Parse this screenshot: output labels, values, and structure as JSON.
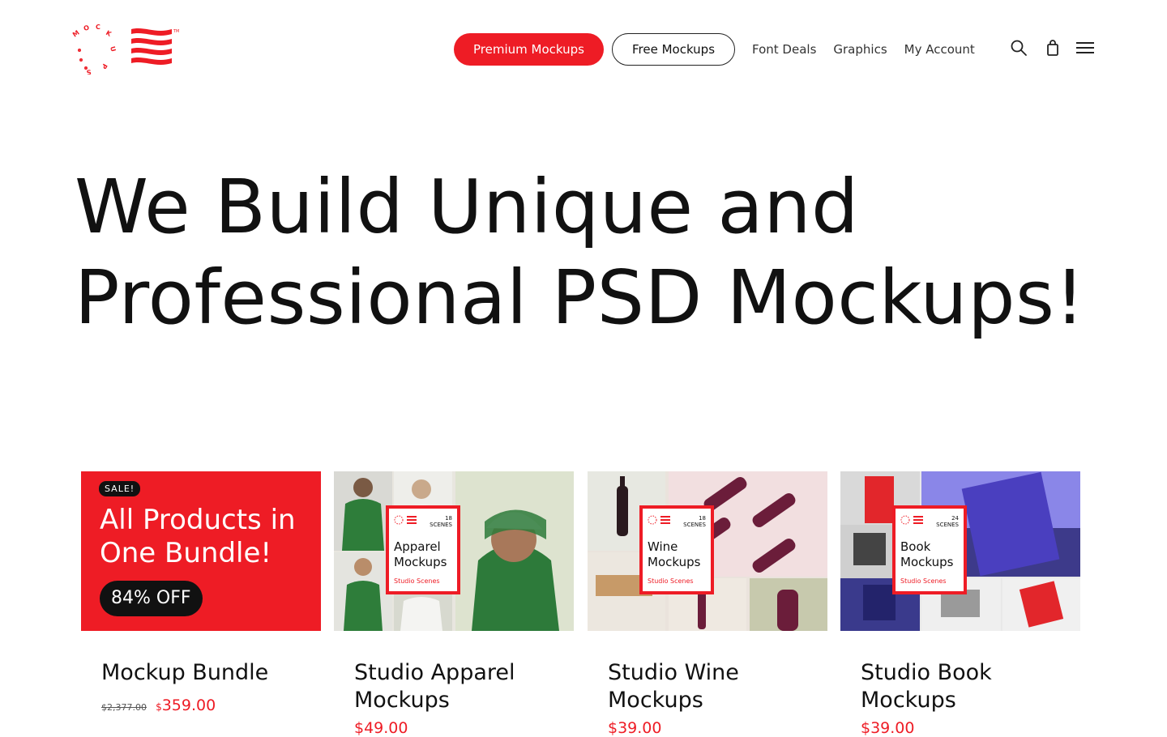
{
  "header": {
    "logo_letters": "MOCKUPS",
    "nav": {
      "premium": "Premium Mockups",
      "free": "Free Mockups",
      "links": [
        "Font Deals",
        "Graphics",
        "My Account"
      ]
    },
    "icons": [
      "search-icon",
      "shopping-bag-icon",
      "hamburger-menu-icon"
    ]
  },
  "hero": {
    "line1": "We Build Unique and",
    "line2": "Professional PSD Mockups!"
  },
  "colors": {
    "accent": "#ee1c25",
    "text": "#111111"
  },
  "products": [
    {
      "badge": "SALE!",
      "headline": "All Products in One Bundle!",
      "discount": "84% OFF",
      "name": "Mockup Bundle",
      "price_old": "$2,377.00",
      "currency": "$",
      "price": "359.00"
    },
    {
      "name": "Studio Apparel Mockups",
      "overlay": {
        "scenes_count": "18",
        "scenes_label": "SCENES",
        "title": "Apparel Mockups",
        "subtitle": "Studio Scenes"
      },
      "price": "$49.00"
    },
    {
      "name": "Studio Wine Mockups",
      "overlay": {
        "scenes_count": "18",
        "scenes_label": "SCENES",
        "title": "Wine Mockups",
        "subtitle": "Studio Scenes"
      },
      "price": "$39.00"
    },
    {
      "name": "Studio Book Mockups",
      "overlay": {
        "scenes_count": "24",
        "scenes_label": "SCENES",
        "title": "Book Mockups",
        "subtitle": "Studio Scenes"
      },
      "price": "$39.00"
    }
  ]
}
